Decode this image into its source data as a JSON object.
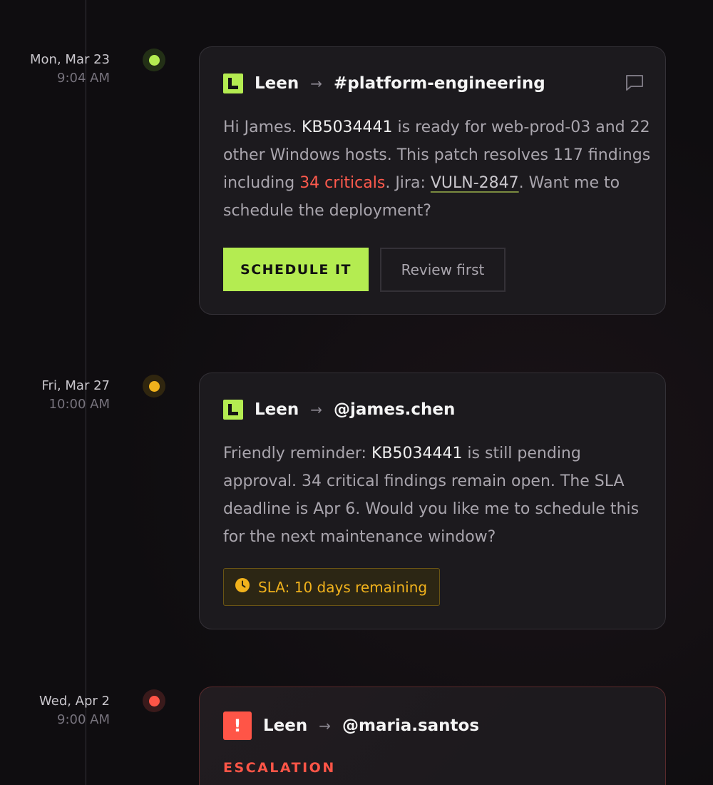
{
  "entries": [
    {
      "date": {
        "day": "Mon, Mar 23",
        "time": "9:04 AM"
      },
      "status_color": "#b4ec51",
      "sender": "Leen",
      "arrow": "→",
      "target": "#platform-engineering",
      "message": {
        "p1": "Hi James. ",
        "kb": "KB5034441",
        "p2": " is ready for web-prod-03 and 22 other Windows hosts. This patch resolves 117 findings including ",
        "criticals": "34 criticals",
        "p3": ". Jira: ",
        "jira": "VULN-2847",
        "p4": ". Want me to schedule the deployment?"
      },
      "primary_button": "SCHEDULE IT",
      "secondary_button": "Review first"
    },
    {
      "date": {
        "day": "Fri, Mar 27",
        "time": "10:00 AM"
      },
      "status_color": "#f1b21c",
      "sender": "Leen",
      "arrow": "→",
      "target": "@james.chen",
      "message": {
        "p1": "Friendly reminder: ",
        "kb": "KB5034441",
        "p2": " is still pending approval. 34 critical findings remain open. The SLA deadline is Apr 6. Would you like me to schedule this for the next maintenance window?"
      },
      "badge": "SLA: 10 days remaining"
    },
    {
      "date": {
        "day": "Wed, Apr 2",
        "time": "9:00 AM"
      },
      "status_color": "#ff5547",
      "sender": "Leen",
      "arrow": "→",
      "target": "@maria.santos",
      "alert_glyph": "!",
      "label": "ESCALATION"
    }
  ]
}
